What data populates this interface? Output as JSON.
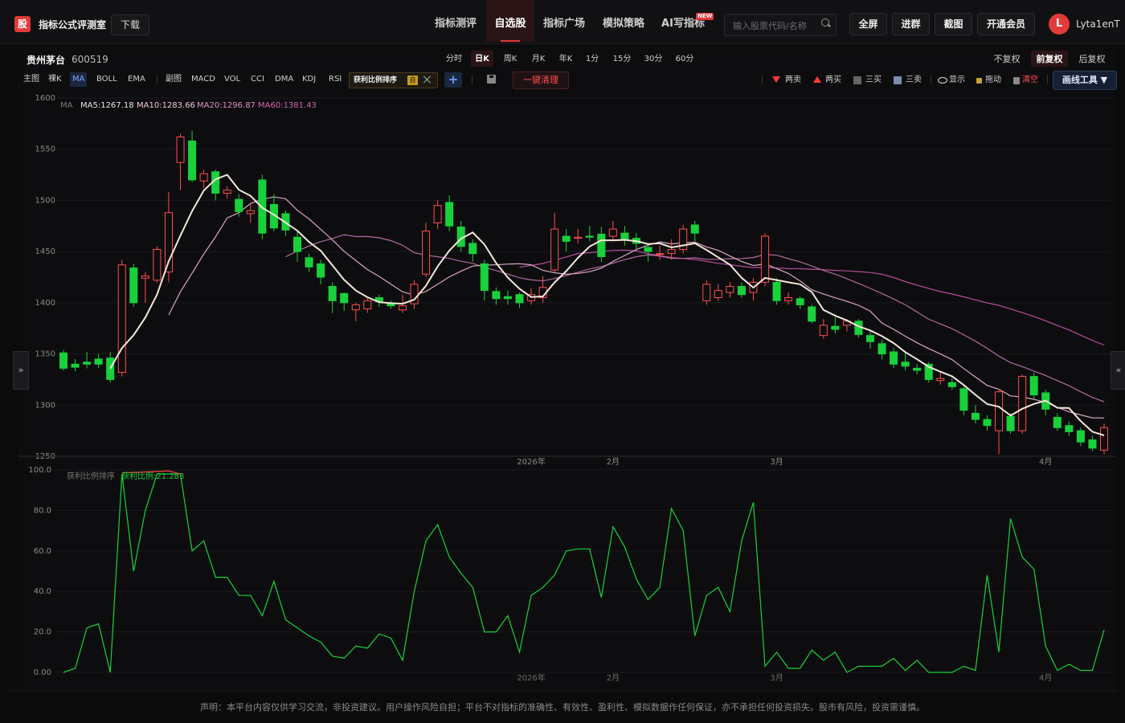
{
  "header": {
    "logo_text": "股",
    "app_title": "指标公式评测室",
    "download_label": "下载",
    "nav": [
      {
        "label": "指标测评",
        "active": false
      },
      {
        "label": "自选股",
        "active": true
      },
      {
        "label": "指标广场",
        "active": false
      },
      {
        "label": "模拟策略",
        "active": false
      },
      {
        "label": "AI写指标",
        "active": false,
        "badge": "NEW"
      }
    ],
    "search_placeholder": "输入股票代码/名称",
    "buttons": [
      "全屏",
      "进群",
      "截图",
      "开通会员"
    ],
    "user_initial": "L",
    "username": "Lyta1enT"
  },
  "stock": {
    "name": "贵州茅台",
    "code": "600519"
  },
  "periods": [
    {
      "label": "分时",
      "active": false
    },
    {
      "label": "日K",
      "active": true
    },
    {
      "label": "周K",
      "active": false
    },
    {
      "label": "月K",
      "active": false
    },
    {
      "label": "年K",
      "active": false
    },
    {
      "label": "1分",
      "active": false
    },
    {
      "label": "15分",
      "active": false
    },
    {
      "label": "30分",
      "active": false
    },
    {
      "label": "60分",
      "active": false
    }
  ],
  "adjust": [
    {
      "label": "不复权",
      "active": false
    },
    {
      "label": "前复权",
      "active": true
    },
    {
      "label": "后复权",
      "active": false
    }
  ],
  "indicators_main": [
    {
      "label": "主图",
      "active": false
    },
    {
      "label": "裸K",
      "active": false
    },
    {
      "label": "MA",
      "active": true
    },
    {
      "label": "BOLL",
      "active": false
    },
    {
      "label": "EMA",
      "active": false
    }
  ],
  "indicators_sub": [
    "副图",
    "MACD",
    "VOL",
    "CCI",
    "DMA",
    "KDJ",
    "RSI"
  ],
  "custom_tag": {
    "label": "获利比例排序",
    "flag": "自"
  },
  "clear_label": "一键清理",
  "actions": [
    {
      "label": "两卖",
      "icon": "sell-down-icon"
    },
    {
      "label": "两买",
      "icon": "buy-up-icon"
    },
    {
      "label": "三买",
      "icon": "three-buy-icon"
    },
    {
      "label": "三卖",
      "icon": "three-sell-icon"
    },
    {
      "label": "显示",
      "icon": "eye-icon"
    },
    {
      "label": "拖动",
      "icon": "lock-icon"
    },
    {
      "label": "清空",
      "icon": "trash-icon"
    }
  ],
  "draw_tools_label": "画线工具 ▼",
  "side_left": "»",
  "side_right": "«",
  "footer": "声明：本平台内容仅供学习交流，非投资建议。用户操作风险自担；平台不对指标的准确性、有效性、盈利性、模拟数据作任何保证，亦不承担任何投资损失。股市有风险，投资需谨慎。",
  "colors": {
    "up": "#ff4d4f",
    "down": "#19d13a",
    "ma5": "#f3e6d8",
    "ma10": "#d9a6c0",
    "ma20": "#b06aa0",
    "ma60": "#b84d9a",
    "sub_line": "#19d13a"
  },
  "chart_data": [
    {
      "type": "candlestick",
      "legend": {
        "label": "MA",
        "items": [
          {
            "name": "MA5",
            "value": "1267.18"
          },
          {
            "name": "MA10",
            "value": "1283.66"
          },
          {
            "name": "MA20",
            "value": "1296.87"
          },
          {
            "name": "MA60",
            "value": "1381.43"
          }
        ]
      },
      "ylim": [
        1250,
        1600
      ],
      "yticks": [
        1250,
        1300,
        1350,
        1400,
        1450,
        1500,
        1550,
        1600
      ],
      "xtick_labels": [
        {
          "label": "2026年",
          "at": 40
        },
        {
          "label": "2月",
          "at": 47
        },
        {
          "label": "3月",
          "at": 61
        },
        {
          "label": "4月",
          "at": 84
        }
      ],
      "ohlc": [
        [
          1351,
          1336,
          1354,
          1334
        ],
        [
          1340,
          1337,
          1345,
          1333
        ],
        [
          1342,
          1340,
          1352,
          1336
        ],
        [
          1345,
          1340,
          1350,
          1336
        ],
        [
          1346,
          1325,
          1352,
          1322
        ],
        [
          1332,
          1437,
          1442,
          1328
        ],
        [
          1434,
          1400,
          1438,
          1396
        ],
        [
          1424,
          1426,
          1430,
          1400
        ],
        [
          1422,
          1452,
          1455,
          1420
        ],
        [
          1430,
          1488,
          1508,
          1420
        ],
        [
          1537,
          1562,
          1565,
          1510
        ],
        [
          1558,
          1520,
          1568,
          1518
        ],
        [
          1519,
          1526,
          1530,
          1512
        ],
        [
          1528,
          1507,
          1530,
          1500
        ],
        [
          1507,
          1510,
          1514,
          1502
        ],
        [
          1501,
          1489,
          1506,
          1484
        ],
        [
          1487,
          1490,
          1498,
          1478
        ],
        [
          1520,
          1468,
          1525,
          1462
        ],
        [
          1496,
          1473,
          1506,
          1470
        ],
        [
          1487,
          1471,
          1490,
          1465
        ],
        [
          1464,
          1450,
          1470,
          1440
        ],
        [
          1444,
          1435,
          1448,
          1430
        ],
        [
          1438,
          1425,
          1442,
          1418
        ],
        [
          1416,
          1402,
          1420,
          1390
        ],
        [
          1409,
          1400,
          1410,
          1392
        ],
        [
          1393,
          1398,
          1400,
          1382
        ],
        [
          1394,
          1402,
          1406,
          1390
        ],
        [
          1405,
          1401,
          1408,
          1396
        ],
        [
          1399,
          1397,
          1402,
          1394
        ],
        [
          1393,
          1397,
          1408,
          1390
        ],
        [
          1399,
          1418,
          1422,
          1394
        ],
        [
          1428,
          1470,
          1478,
          1425
        ],
        [
          1478,
          1495,
          1500,
          1472
        ],
        [
          1498,
          1475,
          1505,
          1470
        ],
        [
          1474,
          1455,
          1480,
          1450
        ],
        [
          1458,
          1448,
          1462,
          1440
        ],
        [
          1438,
          1412,
          1442,
          1402
        ],
        [
          1411,
          1404,
          1415,
          1398
        ],
        [
          1406,
          1404,
          1412,
          1398
        ],
        [
          1408,
          1400,
          1410,
          1395
        ],
        [
          1402,
          1408,
          1414,
          1398
        ],
        [
          1405,
          1415,
          1426,
          1400
        ],
        [
          1432,
          1472,
          1488,
          1430
        ],
        [
          1465,
          1460,
          1472,
          1450
        ],
        [
          1463,
          1464,
          1472,
          1458
        ],
        [
          1465,
          1464,
          1475,
          1460
        ],
        [
          1467,
          1445,
          1474,
          1440
        ],
        [
          1465,
          1472,
          1480,
          1460
        ],
        [
          1468,
          1462,
          1475,
          1456
        ],
        [
          1463,
          1458,
          1468,
          1452
        ],
        [
          1454,
          1450,
          1458,
          1440
        ],
        [
          1448,
          1448,
          1456,
          1442
        ],
        [
          1448,
          1452,
          1462,
          1442
        ],
        [
          1452,
          1472,
          1476,
          1448
        ],
        [
          1476,
          1468,
          1480,
          1460
        ],
        [
          1402,
          1418,
          1422,
          1398
        ],
        [
          1405,
          1412,
          1418,
          1402
        ],
        [
          1410,
          1416,
          1420,
          1405
        ],
        [
          1416,
          1408,
          1420,
          1405
        ],
        [
          1410,
          1420,
          1424,
          1402
        ],
        [
          1420,
          1465,
          1468,
          1416
        ],
        [
          1420,
          1402,
          1424,
          1398
        ],
        [
          1402,
          1405,
          1410,
          1398
        ],
        [
          1404,
          1398,
          1406,
          1394
        ],
        [
          1396,
          1382,
          1398,
          1380
        ],
        [
          1368,
          1378,
          1384,
          1365
        ],
        [
          1377,
          1374,
          1386,
          1370
        ],
        [
          1378,
          1382,
          1384,
          1372
        ],
        [
          1382,
          1369,
          1384,
          1366
        ],
        [
          1368,
          1362,
          1372,
          1355
        ],
        [
          1360,
          1350,
          1364,
          1345
        ],
        [
          1352,
          1340,
          1356,
          1336
        ],
        [
          1342,
          1338,
          1352,
          1334
        ],
        [
          1336,
          1334,
          1340,
          1330
        ],
        [
          1340,
          1325,
          1342,
          1322
        ],
        [
          1324,
          1326,
          1332,
          1320
        ],
        [
          1322,
          1318,
          1326,
          1315
        ],
        [
          1316,
          1295,
          1318,
          1290
        ],
        [
          1292,
          1286,
          1300,
          1282
        ],
        [
          1286,
          1280,
          1290,
          1275
        ],
        [
          1275,
          1313,
          1316,
          1252
        ],
        [
          1289,
          1275,
          1292,
          1272
        ],
        [
          1275,
          1328,
          1330,
          1272
        ],
        [
          1328,
          1310,
          1332,
          1305
        ],
        [
          1312,
          1296,
          1315,
          1290
        ],
        [
          1288,
          1278,
          1292,
          1275
        ],
        [
          1280,
          1274,
          1284,
          1270
        ],
        [
          1275,
          1264,
          1278,
          1260
        ],
        [
          1266,
          1258,
          1270,
          1255
        ],
        [
          1256,
          1278,
          1282,
          1252
        ]
      ]
    },
    {
      "type": "line",
      "title_left": "获利比例排序",
      "series_name": "获利比例",
      "series_value": "21.283",
      "ylim": [
        0,
        100
      ],
      "yticks": [
        "0.00",
        "20.0",
        "40.0",
        "60.0",
        "80.0",
        "100.0"
      ],
      "xtick_labels": [
        "2026年",
        "2月",
        "3月",
        "4月"
      ],
      "values": [
        0,
        2,
        22,
        24,
        0,
        98,
        50,
        80,
        98,
        98,
        98,
        60,
        65,
        47,
        47,
        38,
        38,
        28,
        45,
        26,
        22,
        18,
        15,
        8,
        7,
        13,
        12,
        19,
        17,
        6,
        40,
        65,
        73,
        57,
        49,
        42,
        20,
        20,
        28,
        10,
        38,
        42,
        48,
        60,
        61,
        61,
        37,
        72,
        62,
        46,
        36,
        42,
        81,
        70,
        18,
        38,
        42,
        30,
        65,
        84,
        3,
        10,
        2,
        2,
        11,
        6,
        10,
        0,
        3,
        3,
        3,
        7,
        1,
        6,
        0,
        0,
        0,
        3,
        1,
        48,
        10,
        76,
        57,
        51,
        13,
        1,
        4,
        1,
        1,
        21
      ]
    }
  ]
}
